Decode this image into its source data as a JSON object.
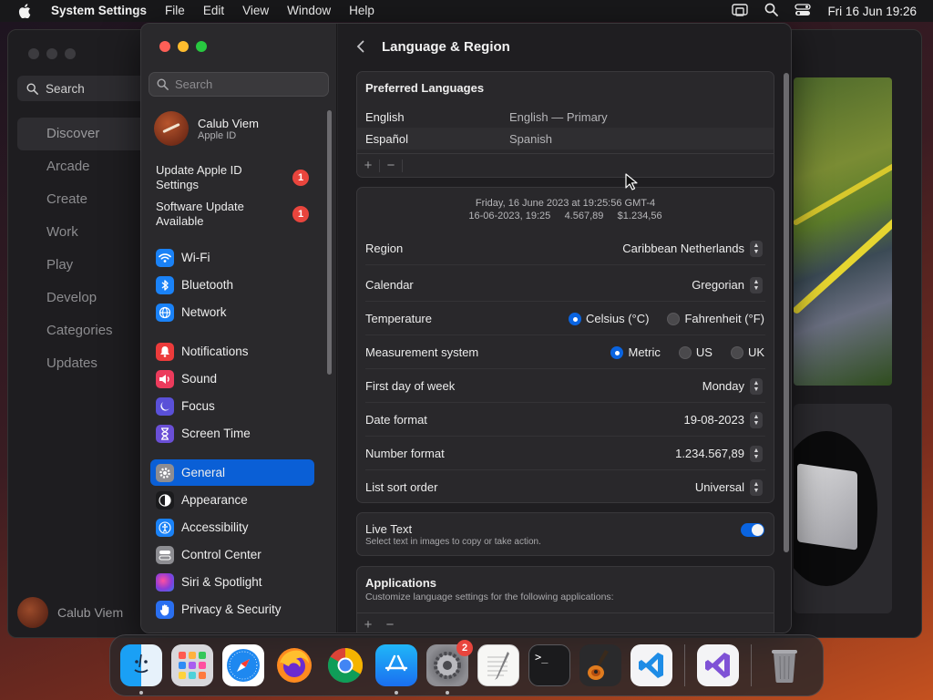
{
  "menubar": {
    "app_name": "System Settings",
    "menus": [
      "File",
      "Edit",
      "View",
      "Window",
      "Help"
    ],
    "clock": "Fri 16 Jun  19:26"
  },
  "background_window": {
    "search_label": "Search",
    "nav": [
      "Discover",
      "Arcade",
      "Create",
      "Work",
      "Play",
      "Develop",
      "Categories",
      "Updates"
    ],
    "user_name": "Calub Viem"
  },
  "sidebar": {
    "search_placeholder": "Search",
    "account": {
      "name": "Calub Viem",
      "subtitle": "Apple ID"
    },
    "notices": [
      {
        "label": "Update Apple ID Settings",
        "count": "1"
      },
      {
        "label": "Software Update Available",
        "count": "1"
      }
    ],
    "items": [
      {
        "label": "Wi-Fi",
        "icon": "wifi-icon",
        "color": "#1a82f7"
      },
      {
        "label": "Bluetooth",
        "icon": "bluetooth-icon",
        "color": "#1a82f7"
      },
      {
        "label": "Network",
        "icon": "globe-icon",
        "color": "#1a82f7"
      },
      {
        "label": "Notifications",
        "icon": "bell-icon",
        "color": "#ec3b3b"
      },
      {
        "label": "Sound",
        "icon": "speaker-icon",
        "color": "#ec3b5c"
      },
      {
        "label": "Focus",
        "icon": "moon-icon",
        "color": "#5a50d8"
      },
      {
        "label": "Screen Time",
        "icon": "hourglass-icon",
        "color": "#6a4fd6"
      },
      {
        "label": "General",
        "icon": "gear-icon",
        "color": "#8d8d92"
      },
      {
        "label": "Appearance",
        "icon": "appearance-icon",
        "color": "#1b1b1d"
      },
      {
        "label": "Accessibility",
        "icon": "accessibility-icon",
        "color": "#1a82f7"
      },
      {
        "label": "Control Center",
        "icon": "control-center-icon",
        "color": "#8d8d92"
      },
      {
        "label": "Siri & Spotlight",
        "icon": "siri-icon",
        "color": "#a03fd8"
      },
      {
        "label": "Privacy & Security",
        "icon": "hand-icon",
        "color": "#2a6ff0"
      }
    ],
    "active_item": "General"
  },
  "detail": {
    "title": "Language & Region",
    "preferred_languages": {
      "title": "Preferred Languages",
      "rows": [
        {
          "language": "English",
          "value": "English — Primary"
        },
        {
          "language": "Español",
          "value": "Spanish"
        }
      ]
    },
    "preview": {
      "line1": "Friday, 16 June 2023 at 19:25:56 GMT-4",
      "line2": "16-06-2023, 19:25     4.567,89     $1.234,56"
    },
    "region": {
      "label": "Region",
      "value": "Caribbean Netherlands"
    },
    "calendar": {
      "label": "Calendar",
      "value": "Gregorian"
    },
    "temperature": {
      "label": "Temperature",
      "options": [
        "Celsius (°C)",
        "Fahrenheit (°F)"
      ],
      "selected": "Celsius (°C)"
    },
    "measurement": {
      "label": "Measurement system",
      "options": [
        "Metric",
        "US",
        "UK"
      ],
      "selected": "Metric"
    },
    "first_day": {
      "label": "First day of week",
      "value": "Monday"
    },
    "date_format": {
      "label": "Date format",
      "value": "19-08-2023"
    },
    "number_format": {
      "label": "Number format",
      "value": "1.234.567,89"
    },
    "sort_order": {
      "label": "List sort order",
      "value": "Universal"
    },
    "live_text": {
      "label": "Live Text",
      "description": "Select text in images to copy or take action.",
      "enabled": true
    },
    "applications": {
      "title": "Applications",
      "description": "Customize language settings for the following applications:"
    }
  },
  "dock": {
    "apps": [
      {
        "name": "Finder",
        "icon": "finder-icon",
        "running": true
      },
      {
        "name": "Launchpad",
        "icon": "launchpad-icon",
        "running": false
      },
      {
        "name": "Safari",
        "icon": "safari-icon",
        "running": false
      },
      {
        "name": "Firefox",
        "icon": "firefox-icon",
        "running": false
      },
      {
        "name": "Chrome",
        "icon": "chrome-icon",
        "running": false
      },
      {
        "name": "App Store",
        "icon": "app-store-icon",
        "running": true
      },
      {
        "name": "System Settings",
        "icon": "system-settings-icon",
        "running": true,
        "badge": "2"
      },
      {
        "name": "TextEdit",
        "icon": "textedit-icon",
        "running": false
      },
      {
        "name": "Terminal",
        "icon": "terminal-icon",
        "running": false
      },
      {
        "name": "GarageBand",
        "icon": "garageband-icon",
        "running": false
      },
      {
        "name": "Visual Studio Code",
        "icon": "vscode-icon",
        "running": false
      },
      {
        "name": "Visual Studio",
        "icon": "visual-studio-icon",
        "running": false
      },
      {
        "name": "Trash",
        "icon": "trash-icon",
        "running": false
      }
    ]
  }
}
